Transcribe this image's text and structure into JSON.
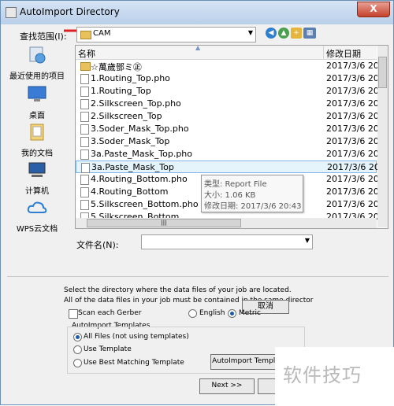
{
  "window": {
    "title": "AutoImport Directory",
    "close_label": "X"
  },
  "lookin": {
    "label": "查找范围(I):",
    "value": "CAM"
  },
  "places": [
    {
      "label": "最近使用的项目"
    },
    {
      "label": "桌面"
    },
    {
      "label": "我的文档"
    },
    {
      "label": "计算机"
    },
    {
      "label": "WPS云文档"
    }
  ],
  "columns": {
    "name": "名称",
    "date": "修改日期"
  },
  "files": [
    {
      "name": "☆萬歲鄧ミ㊣",
      "date": "2017/3/6 20:"
    },
    {
      "name": "1.Routing_Top.pho",
      "date": "2017/3/6 20:"
    },
    {
      "name": "1.Routing_Top",
      "date": "2017/3/6 20:"
    },
    {
      "name": "2.Silkscreen_Top.pho",
      "date": "2017/3/6 20:"
    },
    {
      "name": "2.Silkscreen_Top",
      "date": "2017/3/6 20:"
    },
    {
      "name": "3.Soder_Mask_Top.pho",
      "date": "2017/3/6 20:"
    },
    {
      "name": "3.Soder_Mask_Top",
      "date": "2017/3/6 20:"
    },
    {
      "name": "3a.Paste_Mask_Top.pho",
      "date": "2017/3/6 20:"
    },
    {
      "name": "3a.Paste_Mask_Top",
      "date": "2017/3/6 20:"
    },
    {
      "name": "4.Routing_Bottom.pho",
      "date": "2017/3/6 20:"
    },
    {
      "name": "4.Routing_Bottom",
      "date": "2017/3/6 20:"
    },
    {
      "name": "5.Silkscreen_Bottom.pho",
      "date": "2017/3/6 20:"
    },
    {
      "name": "5.Silkscreen_Bottom",
      "date": "2017/3/6 20:"
    }
  ],
  "tooltip": {
    "type": "类型: Report File",
    "size": "大小: 1.06 KB",
    "modified": "修改日期: 2017/3/6 20:43"
  },
  "filename": {
    "label": "文件名(N):",
    "value": ""
  },
  "info": {
    "line1": "Select the directory where the data files of your job are located.",
    "line2": "All of the data files in your job must be contained in the same director"
  },
  "cancel_label": "取消",
  "options": {
    "scan_each_gerber": "Scan each Gerber",
    "english": "English",
    "metric": "Metric",
    "group_title": "AutoImport Templates",
    "all_files": "All Files (not using templates)",
    "use_template": "Use Template",
    "use_best": "Use Best Matching Template",
    "autoimport_templates_btn": "AutoImport Templa",
    "next_btn": "Next >>"
  },
  "watermark": "软件技巧",
  "colors": {
    "title_bg": "#c9dbf0",
    "selection": "#e5f3fb",
    "close": "#c4412c"
  }
}
